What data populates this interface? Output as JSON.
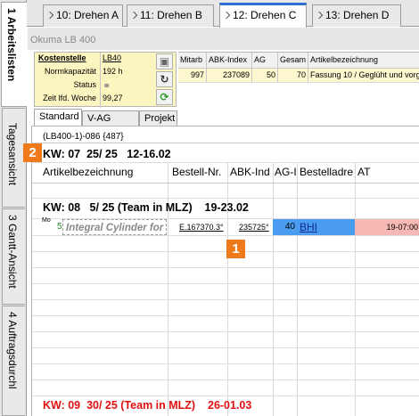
{
  "top_tabs": [
    {
      "label": "10: Drehen A"
    },
    {
      "label": "11: Drehen B"
    },
    {
      "label": "12: Drehen C"
    },
    {
      "label": "13: Drehen D"
    }
  ],
  "side_tabs": [
    {
      "label": "1 Arbeitslisten"
    },
    {
      "label": "Tagesansicht"
    },
    {
      "label": "3 Gantt-Ansicht"
    },
    {
      "label": "4 Auftragsdurchl"
    }
  ],
  "window_title": "Okuma LB 400",
  "info": {
    "kostenstelle_label": "Kostenstelle",
    "kostenstelle_value": "LB40",
    "normkapazitaet_label": "Normkapazität",
    "normkapazitaet_value": "192 h",
    "status_label": "Status",
    "zeit_label": "Zeit lfd. Woche",
    "zeit_value": "99,27"
  },
  "small_grid": {
    "headers": [
      "Mitarb",
      "ABK-Index",
      "AG",
      "Gesam",
      "Artikelbezeichnung"
    ],
    "row": [
      "997",
      "237089",
      "50",
      "70",
      "Fassung 10 / Geglüht und vorg"
    ]
  },
  "sub_tabs": [
    {
      "label": "Standard"
    },
    {
      "label": "V-AG Ende"
    },
    {
      "label": "Projekt"
    }
  ],
  "group_header": "(LB400-1)-086 {487}",
  "kw1": "KW: 07  25/ 25   12-16.02",
  "columns": [
    "Artikelbezeichnung",
    "Bestell-Nr.",
    "ABK-Ind",
    "AG-I",
    "Bestelladre",
    "AT"
  ],
  "kw2": "KW: 08   5/ 25 (Team in MLZ)    19-23.02",
  "row": {
    "day": "Mo",
    "num": "5",
    "article": "Integral Cylinder for",
    "bestell": "E.167370.3°",
    "abk": "235725°",
    "ag": "40",
    "adresse": "BHI",
    "at": "19-07:00"
  },
  "kw3": "KW: 09  30/ 25 (Team in MLZ)    26-01.03",
  "badges": {
    "one": "1",
    "two": "2"
  },
  "colors": {
    "accent": "#2d6fd0",
    "info_bg": "#fbf6c0",
    "ag_bg": "#4a9cf1",
    "at_bg": "#f5b8b3",
    "badge": "#ef7a1c",
    "kw_red": "#e01010"
  }
}
